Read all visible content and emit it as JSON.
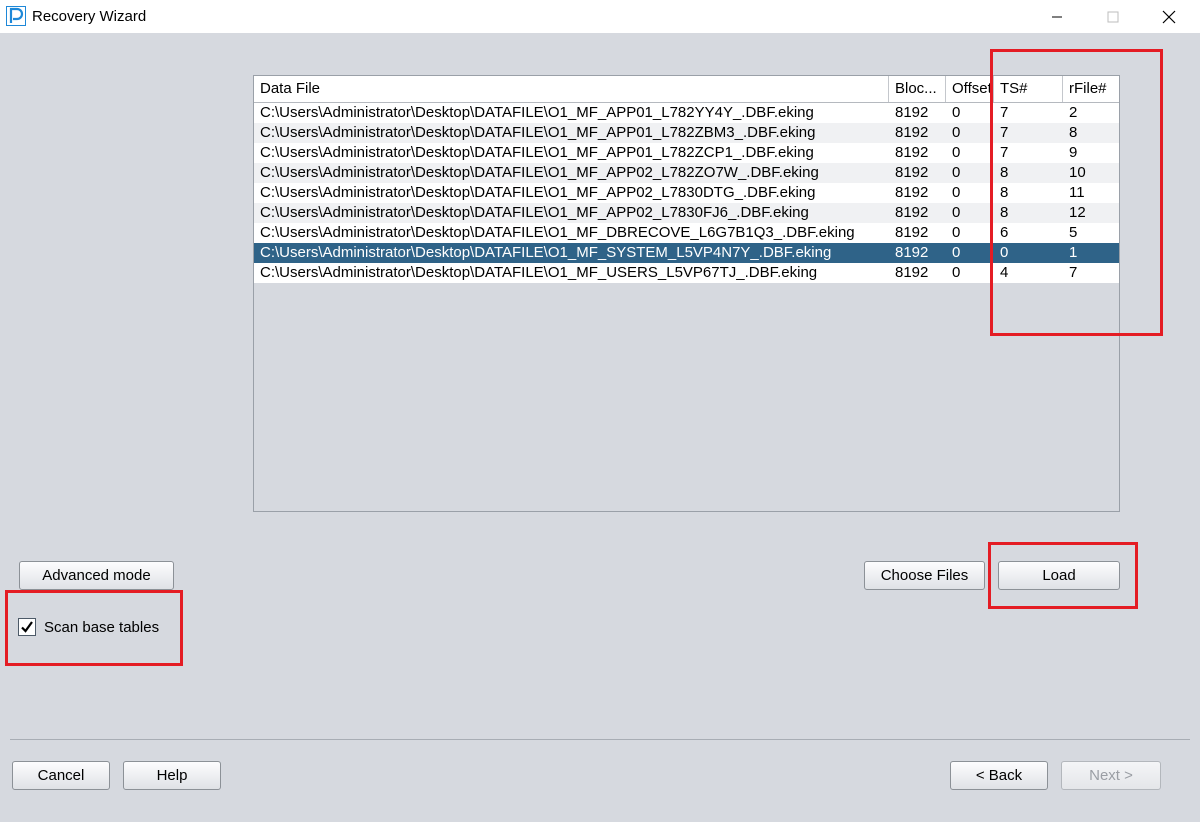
{
  "window": {
    "title": "Recovery Wizard",
    "logo_icon": "p-logo-icon",
    "controls": [
      "minimize-icon",
      "maximize-icon",
      "close-icon"
    ]
  },
  "table": {
    "columns": [
      "Data File",
      "Bloc...",
      "Offset",
      "TS#",
      "rFile#"
    ],
    "rows": [
      {
        "file": "C:\\Users\\Administrator\\Desktop\\DATAFILE\\O1_MF_APP01_L782YY4Y_.DBF.eking",
        "block": "8192",
        "offset": "0",
        "ts": "7",
        "rfile": "2"
      },
      {
        "file": "C:\\Users\\Administrator\\Desktop\\DATAFILE\\O1_MF_APP01_L782ZBM3_.DBF.eking",
        "block": "8192",
        "offset": "0",
        "ts": "7",
        "rfile": "8"
      },
      {
        "file": "C:\\Users\\Administrator\\Desktop\\DATAFILE\\O1_MF_APP01_L782ZCP1_.DBF.eking",
        "block": "8192",
        "offset": "0",
        "ts": "7",
        "rfile": "9"
      },
      {
        "file": "C:\\Users\\Administrator\\Desktop\\DATAFILE\\O1_MF_APP02_L782ZO7W_.DBF.eking",
        "block": "8192",
        "offset": "0",
        "ts": "8",
        "rfile": "10"
      },
      {
        "file": "C:\\Users\\Administrator\\Desktop\\DATAFILE\\O1_MF_APP02_L7830DTG_.DBF.eking",
        "block": "8192",
        "offset": "0",
        "ts": "8",
        "rfile": "11"
      },
      {
        "file": "C:\\Users\\Administrator\\Desktop\\DATAFILE\\O1_MF_APP02_L7830FJ6_.DBF.eking",
        "block": "8192",
        "offset": "0",
        "ts": "8",
        "rfile": "12"
      },
      {
        "file": "C:\\Users\\Administrator\\Desktop\\DATAFILE\\O1_MF_DBRECOVE_L6G7B1Q3_.DBF.eking",
        "block": "8192",
        "offset": "0",
        "ts": "6",
        "rfile": "5"
      },
      {
        "file": "C:\\Users\\Administrator\\Desktop\\DATAFILE\\O1_MF_SYSTEM_L5VP4N7Y_.DBF.eking",
        "block": "8192",
        "offset": "0",
        "ts": "0",
        "rfile": "1"
      },
      {
        "file": "C:\\Users\\Administrator\\Desktop\\DATAFILE\\O1_MF_USERS_L5VP67TJ_.DBF.eking",
        "block": "8192",
        "offset": "0",
        "ts": "4",
        "rfile": "7"
      }
    ],
    "selected_row": 7
  },
  "buttons": {
    "advanced_mode": "Advanced mode",
    "choose_files": "Choose Files",
    "load": "Load",
    "cancel": "Cancel",
    "help": "Help",
    "back": "< Back",
    "next": "Next >"
  },
  "checkbox": {
    "label": "Scan base tables",
    "checked": true
  },
  "colors": {
    "highlight": "#e41c24",
    "selection": "#2f6388",
    "background": "#d6d9df"
  }
}
